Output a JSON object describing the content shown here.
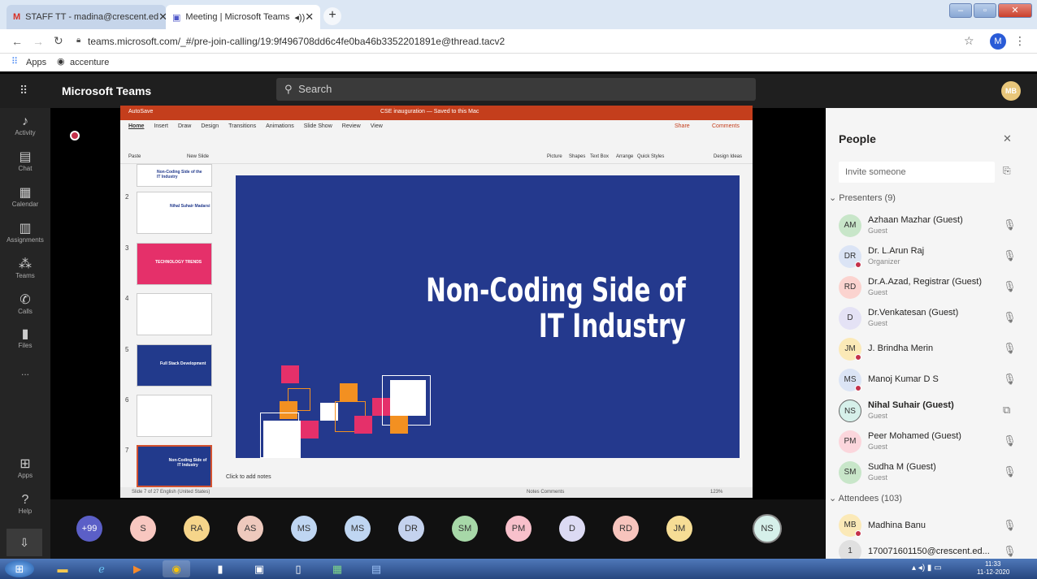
{
  "browser": {
    "tabs": [
      {
        "label": "STAFF TT - madina@crescent.ed",
        "icon": "gmail-icon",
        "active": false
      },
      {
        "label": "Meeting | Microsoft Teams",
        "icon": "teams-icon",
        "active": true
      }
    ],
    "new_tab": "+",
    "url": "teams.microsoft.com/_#/pre-join-calling/19:9f496708dd6c4fe0ba46b3352201891e@thread.tacv2",
    "profile_initial": "M",
    "bookmarks": [
      {
        "label": "Apps"
      },
      {
        "label": "accenture"
      }
    ]
  },
  "teams": {
    "app_title": "Microsoft Teams",
    "search_placeholder": "Search",
    "user_avatar": "MB",
    "rail": [
      {
        "label": "Activity",
        "icon": "bell-icon"
      },
      {
        "label": "Chat",
        "icon": "chat-icon"
      },
      {
        "label": "Calendar",
        "icon": "calendar-icon"
      },
      {
        "label": "Assignments",
        "icon": "assignments-icon"
      },
      {
        "label": "Teams",
        "icon": "teams-group-icon"
      },
      {
        "label": "Calls",
        "icon": "phone-icon"
      },
      {
        "label": "Files",
        "icon": "file-icon"
      },
      {
        "label": "...",
        "icon": "more-icon"
      }
    ],
    "rail_bottom": [
      {
        "label": "Apps",
        "icon": "apps-icon"
      },
      {
        "label": "Help",
        "icon": "help-icon"
      }
    ]
  },
  "ppt": {
    "autosave": "AutoSave",
    "doc_title": "CSE inauguration — Saved to this Mac",
    "menu": [
      "Home",
      "Insert",
      "Draw",
      "Design",
      "Transitions",
      "Animations",
      "Slide Show",
      "Review",
      "View"
    ],
    "share": "Share",
    "comments": "Comments",
    "ribbon": [
      "Paste",
      "New Slide",
      "Picture",
      "Shapes",
      "Text Box",
      "Arrange",
      "Quick Styles",
      "Design Ideas"
    ],
    "thumbs": [
      {
        "num": "",
        "text": "Non-Coding Side of the IT Industry",
        "style": "white"
      },
      {
        "num": "2",
        "text": "Nihal Suhair Madarsi",
        "style": "white"
      },
      {
        "num": "3",
        "text": "TECHNOLOGY TRENDS",
        "style": "pink"
      },
      {
        "num": "4",
        "text": "",
        "style": "white"
      },
      {
        "num": "5",
        "text": "Full Stack Development",
        "style": "blue"
      },
      {
        "num": "6",
        "text": "",
        "style": "white"
      },
      {
        "num": "7",
        "text": "Non-Coding Side of IT Industry",
        "style": "blue"
      }
    ],
    "slide_title_line1": "Non-Coding Side of",
    "slide_title_line2": "IT Industry",
    "notes_placeholder": "Click to add notes",
    "status_left": "Slide 7 of 27   English (United States)",
    "status_right": "Notes   Comments",
    "zoom": "123%"
  },
  "people": {
    "title": "People",
    "invite_placeholder": "Invite someone",
    "presenters_header": "Presenters (9)",
    "attendees_header": "Attendees (103)",
    "presenters": [
      {
        "initials": "AM",
        "name": "Azhaan Mazhar (Guest)",
        "role": "Guest",
        "color": "#c8e6c9",
        "dot": false,
        "bold": false
      },
      {
        "initials": "DR",
        "name": "Dr. L.Arun Raj",
        "role": "Organizer",
        "color": "#dbe4f5",
        "dot": true,
        "bold": false
      },
      {
        "initials": "RD",
        "name": "Dr.A.Azad, Registrar (Guest)",
        "role": "Guest",
        "color": "#fbd3cf",
        "dot": false,
        "bold": false
      },
      {
        "initials": "D",
        "name": "Dr.Venkatesan (Guest)",
        "role": "Guest",
        "color": "#e4e2f5",
        "dot": false,
        "bold": false
      },
      {
        "initials": "JM",
        "name": "J. Brindha Merin",
        "role": "",
        "color": "#fbe9b7",
        "dot": true,
        "bold": false
      },
      {
        "initials": "MS",
        "name": "Manoj Kumar D S",
        "role": "",
        "color": "#dbe4f5",
        "dot": true,
        "bold": false
      },
      {
        "initials": "NS",
        "name": "Nihal Suhair (Guest)",
        "role": "Guest",
        "color": "#d6f0ea",
        "dot": false,
        "bold": true
      },
      {
        "initials": "PM",
        "name": "Peer Mohamed (Guest)",
        "role": "Guest",
        "color": "#fbd6dc",
        "dot": false,
        "bold": false
      },
      {
        "initials": "SM",
        "name": "Sudha M (Guest)",
        "role": "Guest",
        "color": "#c8e6c9",
        "dot": false,
        "bold": false
      }
    ],
    "attendees": [
      {
        "initials": "MB",
        "name": "Madhina Banu",
        "color": "#fbe9b7",
        "dot": true
      },
      {
        "initials": "1",
        "name": "170071601150@crescent.ed...",
        "color": "#e0e0e0",
        "dot": false
      }
    ]
  },
  "strip": {
    "overflow": "+99",
    "avatars": [
      {
        "initials": "S",
        "color": "#f8c7c0"
      },
      {
        "initials": "RA",
        "color": "#f6d58a"
      },
      {
        "initials": "AS",
        "color": "#eec9bd"
      },
      {
        "initials": "MS",
        "color": "#bfd6f2"
      },
      {
        "initials": "MS",
        "color": "#bfd6f2"
      },
      {
        "initials": "DR",
        "color": "#c4d2ee"
      },
      {
        "initials": "SM",
        "color": "#a7d8a8"
      },
      {
        "initials": "PM",
        "color": "#f8c0cb"
      },
      {
        "initials": "D",
        "color": "#dcdaf3"
      },
      {
        "initials": "RD",
        "color": "#f7c4bd"
      },
      {
        "initials": "JM",
        "color": "#f6dd95"
      }
    ],
    "self": "NS"
  },
  "taskbar": {
    "time": "11:33",
    "date": "11-12-2020"
  }
}
